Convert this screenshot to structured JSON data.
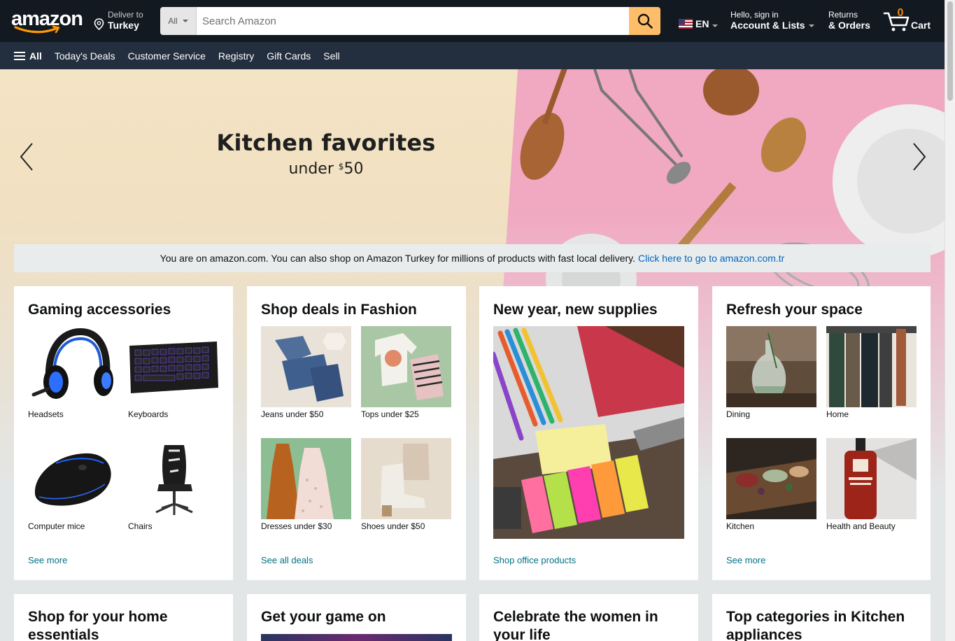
{
  "header": {
    "logo_text": "amazon",
    "deliver_line1": "Deliver to",
    "deliver_line2": "Turkey",
    "search_category": "All",
    "search_placeholder": "Search Amazon",
    "language": "EN",
    "account_line1": "Hello, sign in",
    "account_line2": "Account & Lists",
    "orders_line1": "Returns",
    "orders_line2": "& Orders",
    "cart_count": "0",
    "cart_label": "Cart"
  },
  "subnav": {
    "all_label": "All",
    "links": [
      "Today's Deals",
      "Customer Service",
      "Registry",
      "Gift Cards",
      "Sell"
    ]
  },
  "hero": {
    "title": "Kitchen favorites",
    "subtitle_prefix": "under ",
    "subtitle_currency": "$",
    "subtitle_amount": "50"
  },
  "notice": {
    "text": "You are on amazon.com. You can also shop on Amazon Turkey for millions of products with fast local delivery.",
    "link": "Click here to go to amazon.com.tr"
  },
  "cards": [
    {
      "title": "Gaming accessories",
      "tiles": [
        "Headsets",
        "Keyboards",
        "Computer mice",
        "Chairs"
      ],
      "link": "See more"
    },
    {
      "title": "Shop deals in Fashion",
      "tiles": [
        "Jeans under $50",
        "Tops under $25",
        "Dresses under $30",
        "Shoes under $50"
      ],
      "link": "See all deals"
    },
    {
      "title": "New year, new supplies",
      "link": "Shop office products"
    },
    {
      "title": "Refresh your space",
      "tiles": [
        "Dining",
        "Home",
        "Kitchen",
        "Health and Beauty"
      ],
      "link": "See more"
    }
  ],
  "cards_row2": [
    {
      "title": "Shop for your home essentials"
    },
    {
      "title": "Get your game on"
    },
    {
      "title": "Celebrate the women in your life"
    },
    {
      "title": "Top categories in Kitchen appliances"
    }
  ],
  "colors": {
    "nav_dark": "#131921",
    "nav_secondary": "#232f3e",
    "search_button": "#febd69",
    "cart_count": "#f08804",
    "link": "#007185"
  }
}
